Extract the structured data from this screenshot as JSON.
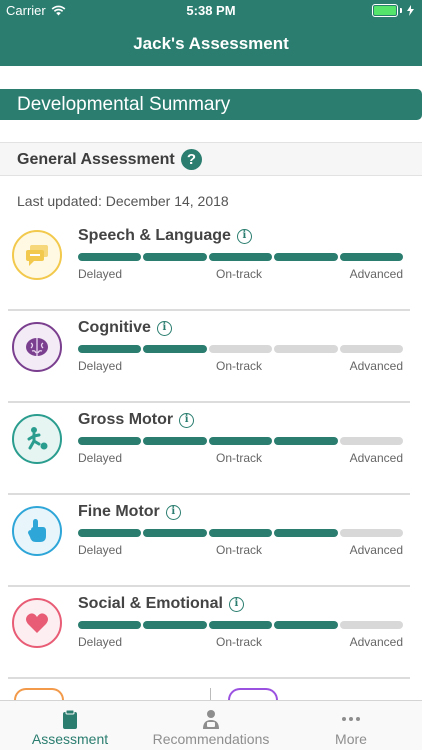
{
  "status_bar": {
    "carrier": "Carrier",
    "time": "5:38 PM"
  },
  "nav": {
    "title": "Jack's Assessment"
  },
  "section": {
    "title": "Developmental Summary"
  },
  "general": {
    "title": "General Assessment",
    "help_icon": "question-mark-icon",
    "help_glyph": "?",
    "last_updated": "Last updated: December 14, 2018"
  },
  "scale_labels": {
    "low": "Delayed",
    "mid": "On-track",
    "high": "Advanced"
  },
  "domains": [
    {
      "label": "Speech & Language",
      "icon": "speech-bubble-icon",
      "color": "#f2c94c",
      "filled_segments": 5,
      "total_segments": 5
    },
    {
      "label": "Cognitive",
      "icon": "brain-icon",
      "color": "#7b3f8f",
      "filled_segments": 2,
      "total_segments": 5
    },
    {
      "label": "Gross Motor",
      "icon": "kicking-ball-icon",
      "color": "#2a9d8f",
      "filled_segments": 4,
      "total_segments": 5
    },
    {
      "label": "Fine Motor",
      "icon": "pointing-hand-icon",
      "color": "#2fa6d8",
      "filled_segments": 4,
      "total_segments": 5
    },
    {
      "label": "Social & Emotional",
      "icon": "heart-icon",
      "color": "#e85d75",
      "filled_segments": 4,
      "total_segments": 5
    }
  ],
  "info_glyph": "i",
  "tabs": [
    {
      "label": "Assessment",
      "icon": "clipboard-icon",
      "active": true
    },
    {
      "label": "Recommendations",
      "icon": "person-icon",
      "active": false
    },
    {
      "label": "More",
      "icon": "ellipsis-icon",
      "active": false
    }
  ],
  "colors": {
    "accent": "#2a7d6f",
    "inactive_segment": "#d8d8d8",
    "peek_left": "#f2994a",
    "peek_right": "#9b51e0"
  }
}
